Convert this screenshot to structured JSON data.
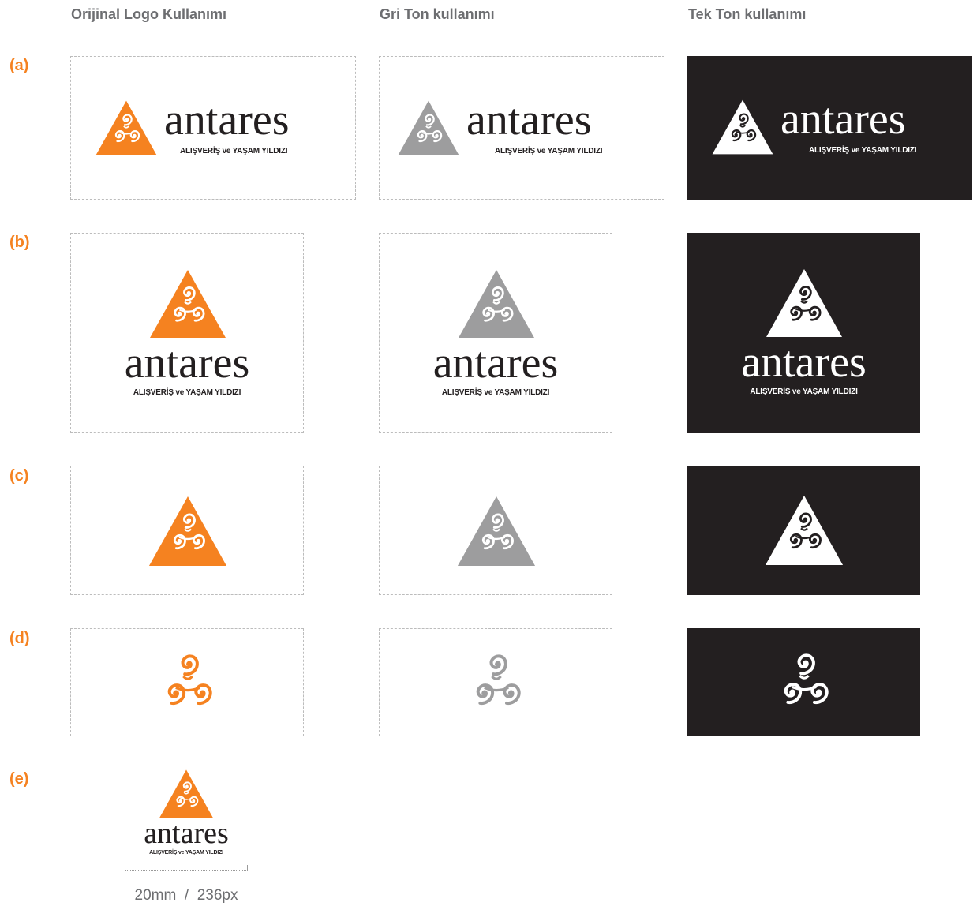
{
  "headers": {
    "original": "Orijinal Logo Kullanımı",
    "gray": "Gri Ton kullanımı",
    "mono": "Tek Ton kullanımı"
  },
  "rows": {
    "a": "(a)",
    "b": "(b)",
    "c": "(c)",
    "d": "(d)",
    "e": "(e)"
  },
  "logo": {
    "wordmark": "antares",
    "tagline": "ALIŞVERİŞ ve YAŞAM YILDIZI"
  },
  "min_size": {
    "mm": "20mm",
    "separator": "/",
    "px": "236px"
  },
  "colors": {
    "brand_orange": "#f58220",
    "gray_tone": "#9d9d9e",
    "dark_background": "#231f20",
    "wordmark_dark": "#231f20",
    "white": "#ffffff",
    "label_gray": "#6d6e71"
  }
}
